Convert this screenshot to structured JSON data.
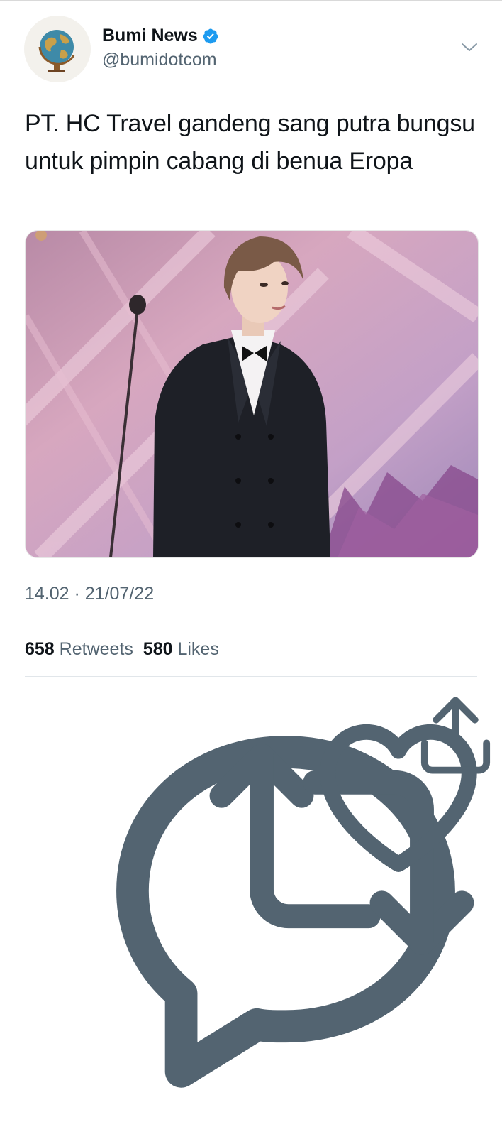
{
  "author": {
    "display_name": "Bumi News",
    "handle": "@bumidotcom",
    "verified": true,
    "avatar_icon": "globe-icon"
  },
  "tweet": {
    "text": "PT. HC Travel gandeng sang putra bungsu untuk pimpin cabang di benua Eropa",
    "timestamp": "14.02 · 21/07/22"
  },
  "stats": {
    "retweets_count": "658",
    "retweets_label": "Retweets",
    "likes_count": "580",
    "likes_label": "Likes"
  },
  "actions": [
    "reply-icon",
    "retweet-icon",
    "like-icon",
    "share-icon"
  ],
  "colors": {
    "accent": "#1d9bf0",
    "secondary_text": "#536471",
    "icon": "#536471"
  }
}
